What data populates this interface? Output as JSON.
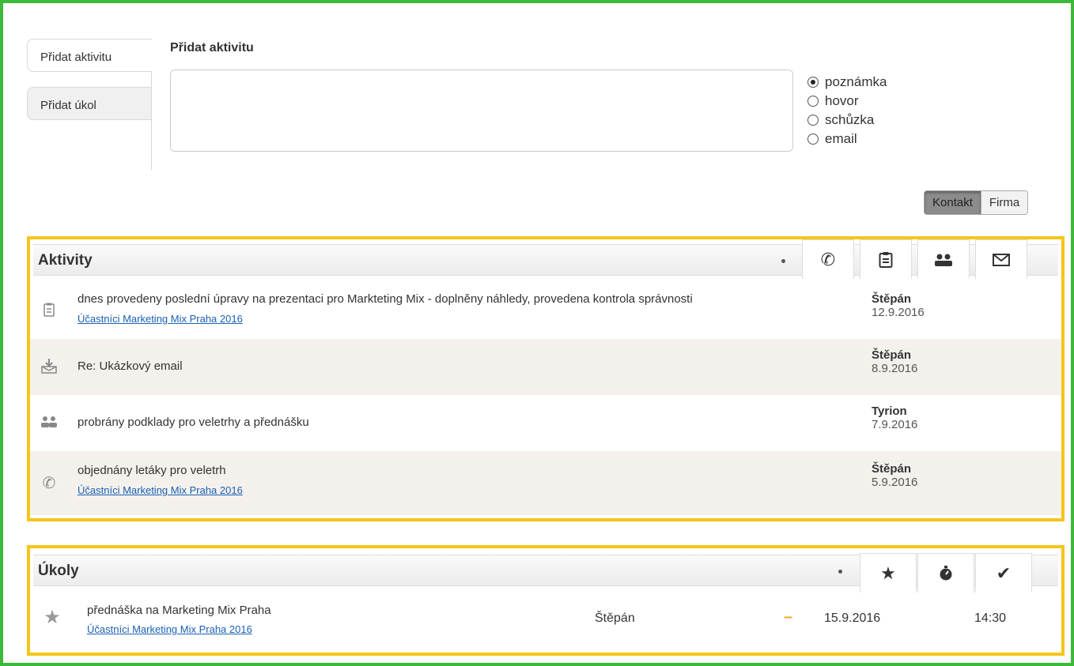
{
  "side_tabs": {
    "add_activity": "Přidat aktivitu",
    "add_task": "Přidat úkol"
  },
  "form": {
    "title": "Přidat aktivitu",
    "note_value": "",
    "types": [
      "poznámka",
      "hovor",
      "schůzka",
      "email"
    ],
    "selected_type": "poznámka"
  },
  "toggle": {
    "contact": "Kontakt",
    "company": "Firma",
    "selected": "Kontakt"
  },
  "activities": {
    "title": "Aktivity",
    "filters": [
      "phone-icon",
      "clipboard-icon",
      "meeting-icon",
      "email-icon"
    ],
    "rows": [
      {
        "icon": "clipboard-icon",
        "text": "dnes provedeny poslední úpravy na prezentaci pro Markteting Mix - doplněny náhledy, provedena kontrola správnosti",
        "link": "Účastníci Marketing Mix Praha 2016",
        "who": "Štěpán",
        "date": "12.9.2016"
      },
      {
        "icon": "inbox-email-icon",
        "text": "Re: Ukázkový email",
        "link": "",
        "who": "Štěpán",
        "date": "8.9.2016"
      },
      {
        "icon": "meeting-icon",
        "text": "probrány podklady pro veletrhy a přednášku",
        "link": "",
        "who": "Tyrion",
        "date": "7.9.2016"
      },
      {
        "icon": "phone-icon",
        "text": "objednány letáky pro veletrh",
        "link": "Účastníci Marketing Mix Praha 2016",
        "who": "Štěpán",
        "date": "5.9.2016"
      }
    ]
  },
  "tasks": {
    "title": "Úkoly",
    "filters": [
      "star-icon",
      "stopwatch-icon",
      "check-icon"
    ],
    "rows": [
      {
        "icon": "star-icon",
        "text": "přednáška na Marketing Mix Praha",
        "link": "Účastníci Marketing Mix Praha 2016",
        "who": "Štěpán",
        "priority": "–",
        "date": "15.9.2016",
        "time": "14:30"
      }
    ]
  },
  "colors": {
    "frame": "#3db83a",
    "highlight": "#f5c518",
    "link": "#1a5fb4",
    "priority": "#f5a623"
  }
}
